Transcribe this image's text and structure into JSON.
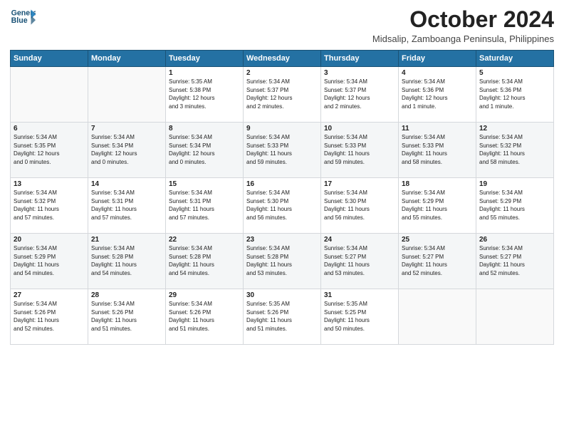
{
  "header": {
    "logo_line1": "General",
    "logo_line2": "Blue",
    "month": "October 2024",
    "subtitle": "Midsalip, Zamboanga Peninsula, Philippines"
  },
  "weekdays": [
    "Sunday",
    "Monday",
    "Tuesday",
    "Wednesday",
    "Thursday",
    "Friday",
    "Saturday"
  ],
  "weeks": [
    [
      {
        "day": "",
        "info": ""
      },
      {
        "day": "",
        "info": ""
      },
      {
        "day": "1",
        "info": "Sunrise: 5:35 AM\nSunset: 5:38 PM\nDaylight: 12 hours\nand 3 minutes."
      },
      {
        "day": "2",
        "info": "Sunrise: 5:34 AM\nSunset: 5:37 PM\nDaylight: 12 hours\nand 2 minutes."
      },
      {
        "day": "3",
        "info": "Sunrise: 5:34 AM\nSunset: 5:37 PM\nDaylight: 12 hours\nand 2 minutes."
      },
      {
        "day": "4",
        "info": "Sunrise: 5:34 AM\nSunset: 5:36 PM\nDaylight: 12 hours\nand 1 minute."
      },
      {
        "day": "5",
        "info": "Sunrise: 5:34 AM\nSunset: 5:36 PM\nDaylight: 12 hours\nand 1 minute."
      }
    ],
    [
      {
        "day": "6",
        "info": "Sunrise: 5:34 AM\nSunset: 5:35 PM\nDaylight: 12 hours\nand 0 minutes."
      },
      {
        "day": "7",
        "info": "Sunrise: 5:34 AM\nSunset: 5:34 PM\nDaylight: 12 hours\nand 0 minutes."
      },
      {
        "day": "8",
        "info": "Sunrise: 5:34 AM\nSunset: 5:34 PM\nDaylight: 12 hours\nand 0 minutes."
      },
      {
        "day": "9",
        "info": "Sunrise: 5:34 AM\nSunset: 5:33 PM\nDaylight: 11 hours\nand 59 minutes."
      },
      {
        "day": "10",
        "info": "Sunrise: 5:34 AM\nSunset: 5:33 PM\nDaylight: 11 hours\nand 59 minutes."
      },
      {
        "day": "11",
        "info": "Sunrise: 5:34 AM\nSunset: 5:33 PM\nDaylight: 11 hours\nand 58 minutes."
      },
      {
        "day": "12",
        "info": "Sunrise: 5:34 AM\nSunset: 5:32 PM\nDaylight: 11 hours\nand 58 minutes."
      }
    ],
    [
      {
        "day": "13",
        "info": "Sunrise: 5:34 AM\nSunset: 5:32 PM\nDaylight: 11 hours\nand 57 minutes."
      },
      {
        "day": "14",
        "info": "Sunrise: 5:34 AM\nSunset: 5:31 PM\nDaylight: 11 hours\nand 57 minutes."
      },
      {
        "day": "15",
        "info": "Sunrise: 5:34 AM\nSunset: 5:31 PM\nDaylight: 11 hours\nand 57 minutes."
      },
      {
        "day": "16",
        "info": "Sunrise: 5:34 AM\nSunset: 5:30 PM\nDaylight: 11 hours\nand 56 minutes."
      },
      {
        "day": "17",
        "info": "Sunrise: 5:34 AM\nSunset: 5:30 PM\nDaylight: 11 hours\nand 56 minutes."
      },
      {
        "day": "18",
        "info": "Sunrise: 5:34 AM\nSunset: 5:29 PM\nDaylight: 11 hours\nand 55 minutes."
      },
      {
        "day": "19",
        "info": "Sunrise: 5:34 AM\nSunset: 5:29 PM\nDaylight: 11 hours\nand 55 minutes."
      }
    ],
    [
      {
        "day": "20",
        "info": "Sunrise: 5:34 AM\nSunset: 5:29 PM\nDaylight: 11 hours\nand 54 minutes."
      },
      {
        "day": "21",
        "info": "Sunrise: 5:34 AM\nSunset: 5:28 PM\nDaylight: 11 hours\nand 54 minutes."
      },
      {
        "day": "22",
        "info": "Sunrise: 5:34 AM\nSunset: 5:28 PM\nDaylight: 11 hours\nand 54 minutes."
      },
      {
        "day": "23",
        "info": "Sunrise: 5:34 AM\nSunset: 5:28 PM\nDaylight: 11 hours\nand 53 minutes."
      },
      {
        "day": "24",
        "info": "Sunrise: 5:34 AM\nSunset: 5:27 PM\nDaylight: 11 hours\nand 53 minutes."
      },
      {
        "day": "25",
        "info": "Sunrise: 5:34 AM\nSunset: 5:27 PM\nDaylight: 11 hours\nand 52 minutes."
      },
      {
        "day": "26",
        "info": "Sunrise: 5:34 AM\nSunset: 5:27 PM\nDaylight: 11 hours\nand 52 minutes."
      }
    ],
    [
      {
        "day": "27",
        "info": "Sunrise: 5:34 AM\nSunset: 5:26 PM\nDaylight: 11 hours\nand 52 minutes."
      },
      {
        "day": "28",
        "info": "Sunrise: 5:34 AM\nSunset: 5:26 PM\nDaylight: 11 hours\nand 51 minutes."
      },
      {
        "day": "29",
        "info": "Sunrise: 5:34 AM\nSunset: 5:26 PM\nDaylight: 11 hours\nand 51 minutes."
      },
      {
        "day": "30",
        "info": "Sunrise: 5:35 AM\nSunset: 5:26 PM\nDaylight: 11 hours\nand 51 minutes."
      },
      {
        "day": "31",
        "info": "Sunrise: 5:35 AM\nSunset: 5:25 PM\nDaylight: 11 hours\nand 50 minutes."
      },
      {
        "day": "",
        "info": ""
      },
      {
        "day": "",
        "info": ""
      }
    ]
  ]
}
